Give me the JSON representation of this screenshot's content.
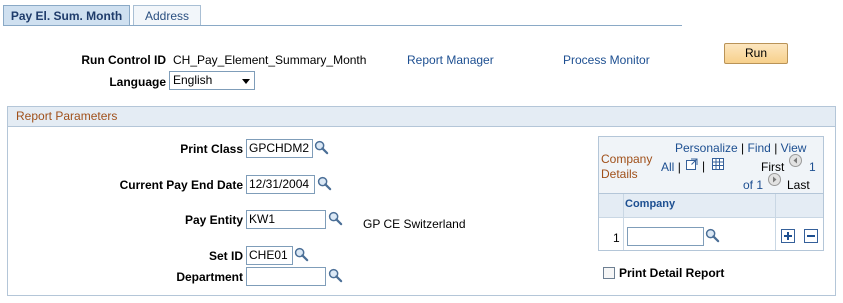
{
  "tabs": [
    {
      "label": "Pay El. Sum. Month",
      "active": true
    },
    {
      "label": "Address",
      "active": false
    }
  ],
  "header": {
    "run_control_label": "Run Control ID",
    "run_control_value": "CH_Pay_Element_Summary_Month",
    "report_manager_link": "Report Manager",
    "process_monitor_link": "Process Monitor",
    "run_button": "Run",
    "language_label": "Language",
    "language_value": "English"
  },
  "report_parameters": {
    "title": "Report Parameters",
    "print_class_label": "Print Class",
    "print_class_value": "GPCHDM2",
    "current_pay_end_date_label": "Current Pay End Date",
    "current_pay_end_date_value": "12/31/2004",
    "pay_entity_label": "Pay Entity",
    "pay_entity_value": "KW1",
    "pay_entity_description": "GP CE Switzerland",
    "set_id_label": "Set ID",
    "set_id_value": "CHE01",
    "department_label": "Department",
    "department_value": ""
  },
  "company_grid": {
    "title_line1": "Company",
    "title_line2": "Details",
    "personalize_link": "Personalize",
    "find_link": "Find",
    "view_link": "View",
    "all_link": "All",
    "first_label": "First",
    "first_page": "1",
    "of_label": "of 1",
    "last_label": "Last",
    "column_header": "Company",
    "rows": [
      {
        "num": "1",
        "company": ""
      }
    ]
  },
  "print_detail_report": {
    "label": "Print Detail Report",
    "checked": false
  },
  "colors": {
    "tab_active_bg": "#cfe0f0",
    "link": "#1d4f91",
    "group_title": "#a0501a",
    "run_button": "#f7d08b"
  },
  "icons": [
    "lookup-icon",
    "add-row-icon",
    "delete-row-icon",
    "new-window-icon",
    "grid-icon",
    "previous-icon",
    "next-icon"
  ]
}
